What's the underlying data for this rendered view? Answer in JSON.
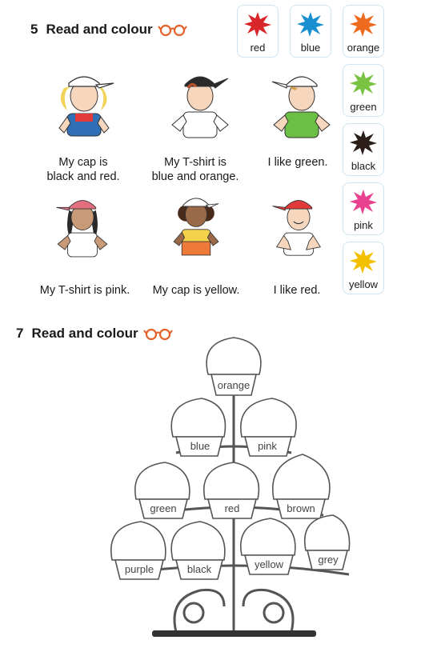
{
  "section5": {
    "number": "5",
    "title": "Read and colour",
    "captions": [
      "My cap is\nblack and red.",
      "My T-shirt is\nblue and orange.",
      "I like green.",
      "My T-shirt is pink.",
      "My cap is yellow.",
      "I like red."
    ],
    "paints": [
      {
        "label": "red",
        "color": "#d9262a"
      },
      {
        "label": "blue",
        "color": "#1a8fd0"
      },
      {
        "label": "orange",
        "color": "#ee6a1f"
      },
      {
        "label": "green",
        "color": "#7ac242"
      },
      {
        "label": "black",
        "color": "#2b1d17"
      },
      {
        "label": "pink",
        "color": "#e8418f"
      },
      {
        "label": "yellow",
        "color": "#f2c000"
      }
    ]
  },
  "section7": {
    "number": "7",
    "title": "Read and colour",
    "cupcakes": [
      "orange",
      "blue",
      "pink",
      "green",
      "red",
      "brown",
      "purple",
      "black",
      "yellow",
      "grey"
    ]
  },
  "colors": {
    "glasses": "#e4612a",
    "accent_border": "#cde6ef"
  }
}
